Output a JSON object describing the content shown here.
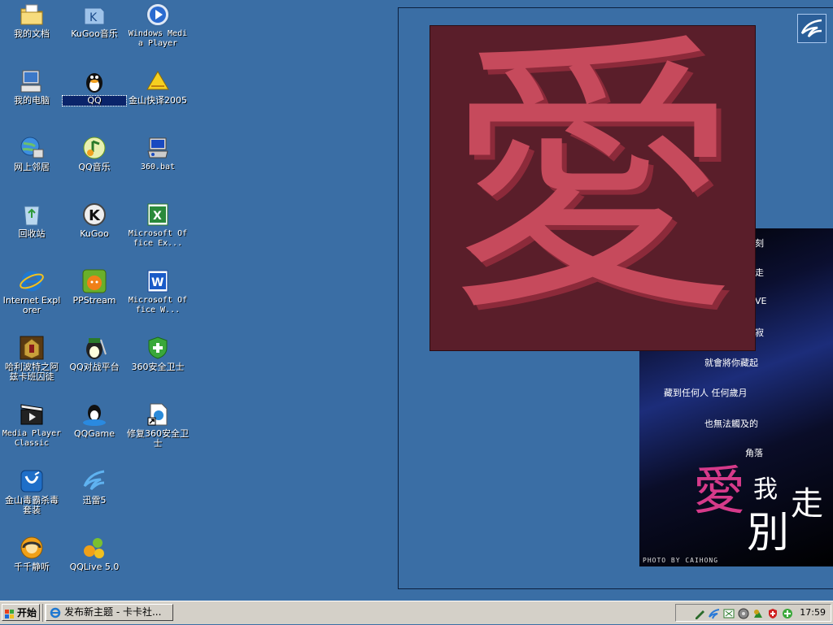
{
  "desktop": {
    "icons": [
      {
        "label": "我的文档",
        "icon": "my-documents-icon"
      },
      {
        "label": "KuGoo音乐",
        "icon": "kugoo-music-icon"
      },
      {
        "label": "Windows Media Player",
        "icon": "windows-media-player-icon"
      },
      {
        "label": "我的电脑",
        "icon": "my-computer-icon"
      },
      {
        "label": "QQ",
        "icon": "qq-icon"
      },
      {
        "label": "金山快译2005",
        "icon": "kingsoft-translate-icon"
      },
      {
        "label": "网上邻居",
        "icon": "network-places-icon"
      },
      {
        "label": "QQ音乐",
        "icon": "qq-music-icon"
      },
      {
        "label": "360.bat",
        "icon": "bat-file-icon"
      },
      {
        "label": "回收站",
        "icon": "recycle-bin-icon"
      },
      {
        "label": "KuGoo",
        "icon": "kugoo-icon"
      },
      {
        "label": "Microsoft Office Ex...",
        "icon": "excel-icon"
      },
      {
        "label": "Internet Explorer",
        "icon": "internet-explorer-icon"
      },
      {
        "label": "PPStream",
        "icon": "ppstream-icon"
      },
      {
        "label": "Microsoft Office W...",
        "icon": "word-icon"
      },
      {
        "label": "哈利波特之阿兹卡班囚徒",
        "icon": "harry-potter-game-icon"
      },
      {
        "label": "QQ对战平台",
        "icon": "qq-battle-platform-icon"
      },
      {
        "label": "360安全卫士",
        "icon": "360-safeguard-icon"
      },
      {
        "label": "Media Player Classic",
        "icon": "media-player-classic-icon"
      },
      {
        "label": "QQGame",
        "icon": "qqgame-icon"
      },
      {
        "label": "修复360安全卫士",
        "icon": "repair-360-shortcut-icon"
      },
      {
        "label": "金山毒霸杀毒套装",
        "icon": "kingsoft-antivirus-icon"
      },
      {
        "label": "迅雷5",
        "icon": "thunder-icon"
      },
      {
        "label": "千千静听",
        "icon": "ttplayer-icon"
      },
      {
        "label": "QQLive 5.0",
        "icon": "qqlive-icon"
      }
    ]
  },
  "wallpaper": {
    "main_glyph": "愛",
    "poster_lines": [
      "刻",
      "走",
      "VE",
      "寂",
      "就會將你藏起",
      "藏到任何人  任何歲月",
      "也無法觸及的",
      "角落"
    ],
    "poster_title_1": "愛",
    "poster_title_2": "我",
    "poster_title_3": "走",
    "poster_title_4": "別",
    "poster_credit": "PHOTO BY CAIHONG"
  },
  "taskbar": {
    "start_label": "开始",
    "task_label": "发布新主题 - 卡卡社...",
    "clock": "17:59",
    "tray_icons": [
      "pen-icon",
      "thunder-tray-icon",
      "network-tray-icon",
      "sound-tray-icon",
      "qq-tray-icon",
      "antivirus-tray-icon",
      "360-tray-icon"
    ]
  },
  "colors": {
    "desktop_bg": "#3a6ea5",
    "glyph_color": "#c64a5c",
    "glyph_bg": "#5a1e2a",
    "taskbar_bg": "#d4d0c8"
  }
}
